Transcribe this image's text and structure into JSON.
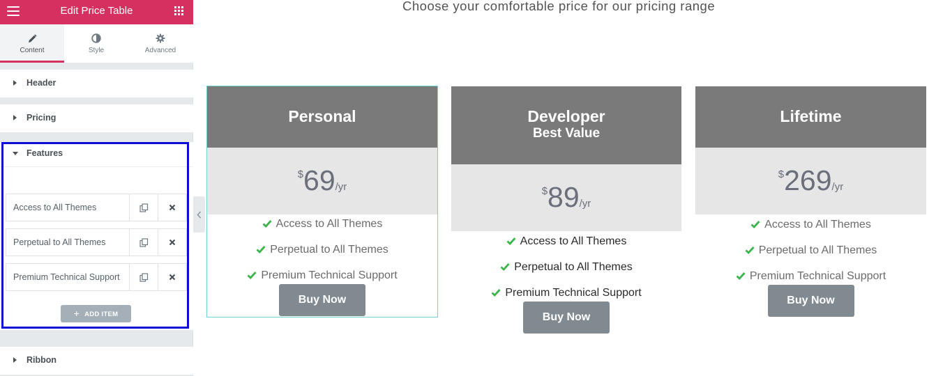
{
  "topbar": {
    "title": "Edit Price Table"
  },
  "tabs": [
    {
      "label": "Content",
      "icon": "pencil-icon"
    },
    {
      "label": "Style",
      "icon": "half-circle-icon"
    },
    {
      "label": "Advanced",
      "icon": "gear-icon"
    }
  ],
  "sections": {
    "header": "Header",
    "pricing": "Pricing",
    "features": "Features",
    "ribbon": "Ribbon"
  },
  "feature_items": [
    "Access to All Themes",
    "Perpetual to All Themes",
    "Premium Technical Support"
  ],
  "add_item_label": "ADD ITEM",
  "preview": {
    "tagline": "Choose your comfortable price for our pricing range",
    "cards": [
      {
        "name": "Personal",
        "subtitle": "",
        "currency": "$",
        "price": "69",
        "period": "/yr",
        "features": [
          "Access to All Themes",
          "Perpetual to All Themes",
          "Premium Technical Support"
        ],
        "button": "Buy Now"
      },
      {
        "name": "Developer",
        "subtitle": "Best Value",
        "currency": "$",
        "price": "89",
        "period": "/yr",
        "features": [
          "Access to All Themes",
          "Perpetual to All Themes",
          "Premium Technical Support"
        ],
        "button": "Buy Now"
      },
      {
        "name": "Lifetime",
        "subtitle": "",
        "currency": "$",
        "price": "269",
        "period": "/yr",
        "features": [
          "Access to All Themes",
          "Perpetual to All Themes",
          "Premium Technical Support"
        ],
        "button": "Buy Now"
      }
    ]
  },
  "colors": {
    "accent": "#d5305f",
    "check": "#39b54a",
    "card_header": "#7a7a7a",
    "button": "#818a91",
    "highlight": "#0d0dd6"
  }
}
